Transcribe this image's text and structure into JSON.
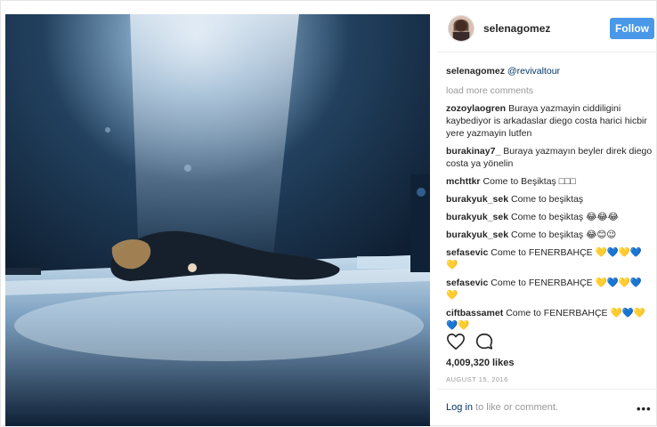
{
  "post": {
    "username": "selenagomez",
    "follow_label": "Follow"
  },
  "caption": {
    "user": "selenagomez",
    "text": "@revivaltour"
  },
  "load_more": "load more comments",
  "comments": [
    {
      "user": "zozoylaogren",
      "text": "Buraya yazmayin ciddiligini kaybediyor is arkadaslar diego costa harici hicbir yere yazmayin lutfen"
    },
    {
      "user": "burakinay7_",
      "text": "Buraya yazmayın beyler direk diego costa ya yönelin"
    },
    {
      "user": "mchttkr",
      "text": "Come to Beşiktaş □□□"
    },
    {
      "user": "burakyuk_sek",
      "text": "Come to beşiktaş"
    },
    {
      "user": "burakyuk_sek",
      "text": "Come to beşiktaş 😂😂😂"
    },
    {
      "user": "burakyuk_sek",
      "text": "Come to beşiktaş 😂😊😉"
    },
    {
      "user": "sefasevic",
      "text": "Come to FENERBAHÇE 💛💙💛💙 💛"
    },
    {
      "user": "sefasevic",
      "text": "Come to FENERBAHÇE 💛💙💛💙 💛"
    },
    {
      "user": "ciftbassamet",
      "text": "Come to FENERBAHÇE 💛💙💛 💙💛"
    }
  ],
  "likes": "4,009,320 likes",
  "date": "AUGUST 15, 2016",
  "footer": {
    "login_link": "Log in",
    "login_text": " to like or comment.",
    "more_dots": "•••"
  },
  "icons": {
    "like": "heart-outline-icon",
    "comment": "comment-bubble-icon",
    "more": "ellipsis-icon"
  },
  "colors": {
    "follow_button": "#4a98e8",
    "link": "#003569",
    "muted": "#999999"
  }
}
